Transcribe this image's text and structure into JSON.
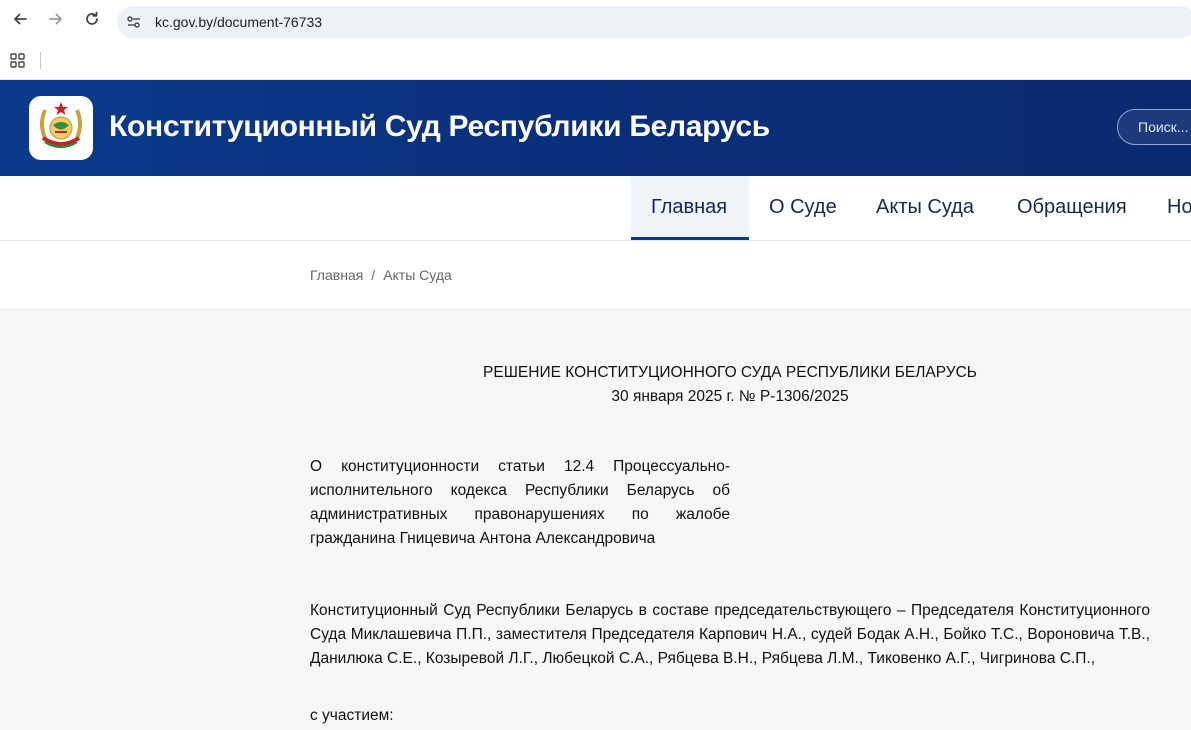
{
  "browser": {
    "url": "kc.gov.by/document-76733"
  },
  "site": {
    "title": "Конституционный Суд Республики Беларусь",
    "search_placeholder": "Поиск...",
    "colors": {
      "header_bg": "#0b3a8c",
      "nav_active_underline": "#0b3a8c"
    }
  },
  "nav": {
    "items": [
      {
        "label": "Главная",
        "active": true
      },
      {
        "label": "О Суде"
      },
      {
        "label": "Акты Суда"
      },
      {
        "label": "Обращения"
      },
      {
        "label": "Но"
      }
    ]
  },
  "breadcrumb": {
    "items": [
      "Главная",
      "Акты Суда"
    ],
    "separator": "/"
  },
  "document": {
    "heading_line1": "РЕШЕНИЕ КОНСТИТУЦИОННОГО СУДА РЕСПУБЛИКИ БЕЛАРУСЬ",
    "heading_line2": "30 января 2025 г. № Р-1306/2025",
    "subject": "О конституционности статьи 12.4 Процессуально-исполнительного кодекса Республики Беларусь об административных правонарушениях по жалобе гражданина Гницевича Антона Александровича",
    "composition": "Конституционный Суд Республики Беларусь в составе председательствующего – Председателя Конституционного Суда Миклашевича П.П., заместителя Председателя Карпович Н.А., судей Бодак А.Н., Бойко Т.С., Вороновича Т.В., Данилюка С.Е., Козыревой Л.Г., Любецкой С.А., Рябцева В.Н., Рябцева Л.М., Тиковенко А.Г., Чигринова С.П.,",
    "participation": "с участием:"
  }
}
